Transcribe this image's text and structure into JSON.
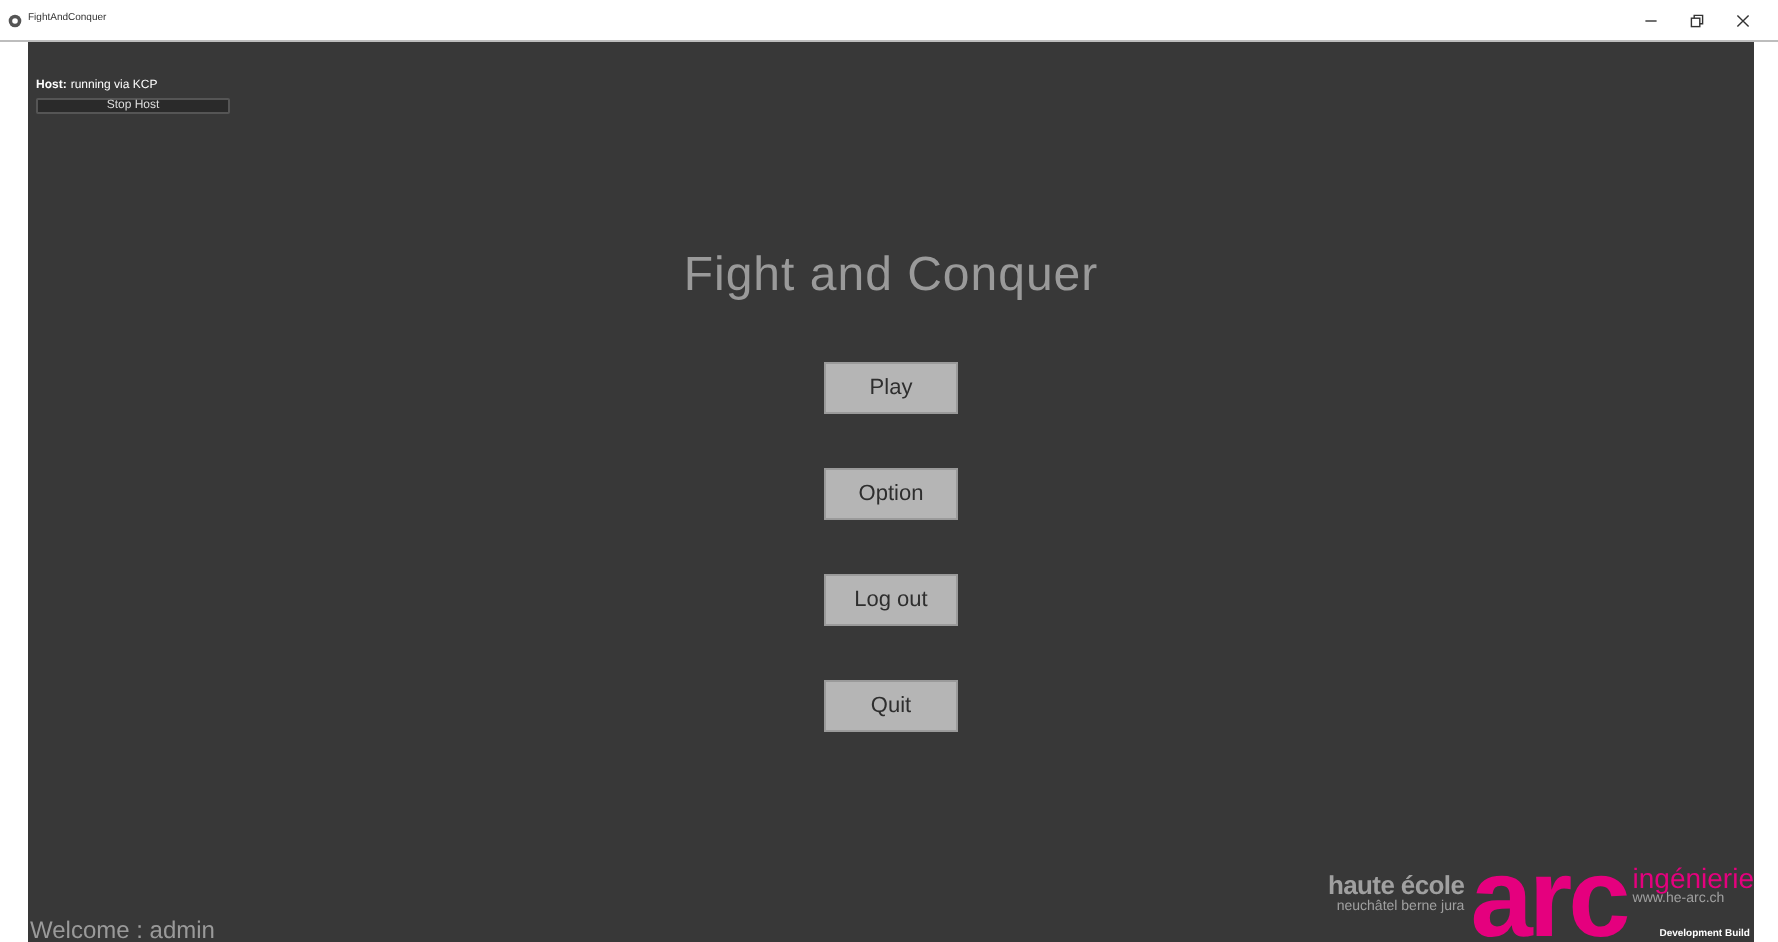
{
  "window": {
    "title": "FightAndConquer"
  },
  "network": {
    "label": "Host:",
    "status": "running via KCP",
    "button": "Stop Host"
  },
  "menu": {
    "title": "Fight and Conquer",
    "buttons": [
      "Play",
      "Option",
      "Log out",
      "Quit"
    ]
  },
  "welcome": "Welcome : admin",
  "logo": {
    "school": "haute école",
    "region": "neuchâtel berne jura",
    "mark": "arc",
    "department": "ingénierie",
    "url": "www.he-arc.ch"
  },
  "build_label": "Development Build"
}
